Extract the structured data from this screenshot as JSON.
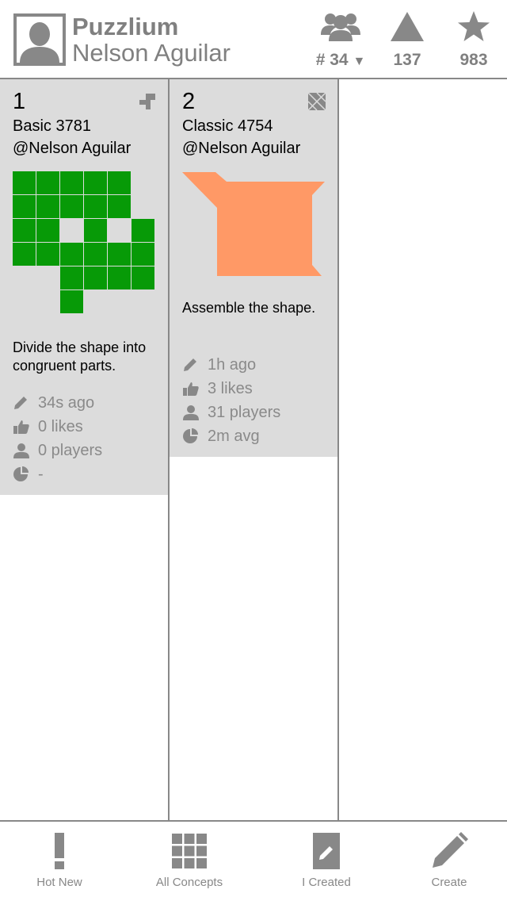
{
  "header": {
    "app_title": "Puzzlium",
    "user_name": "Nelson Aguilar",
    "stats": {
      "rank": "# 34",
      "triangles": "137",
      "stars": "983"
    }
  },
  "puzzles": [
    {
      "number": "1",
      "title": "Basic 3781",
      "author": "@Nelson Aguilar",
      "description": "Divide the shape into congruent parts.",
      "edited": "34s ago",
      "likes": "0 likes",
      "players": "0 players",
      "avg": "-",
      "shape_color": "#079a07"
    },
    {
      "number": "2",
      "title": "Classic 4754",
      "author": "@Nelson Aguilar",
      "description": "Assemble the shape.",
      "edited": "1h ago",
      "likes": "3 likes",
      "players": "31 players",
      "avg": "2m avg",
      "shape_color": "#ff9966"
    }
  ],
  "nav": {
    "hot_new": "Hot New",
    "all_concepts": "All Concepts",
    "i_created": "I Created",
    "create": "Create"
  },
  "colors": {
    "accent_gray": "#808080",
    "card_bg": "#dcdcdc",
    "green": "#079a07",
    "orange": "#ff9966"
  }
}
